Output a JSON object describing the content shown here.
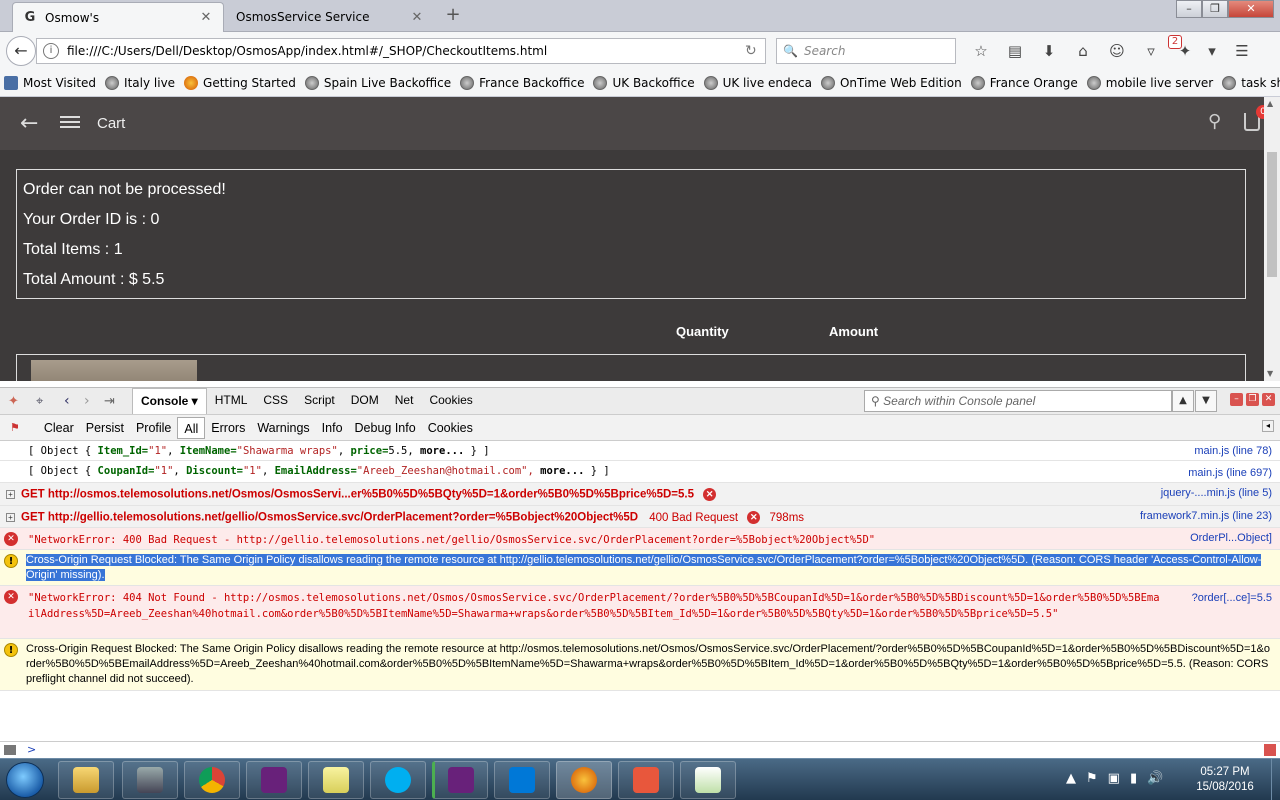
{
  "browser": {
    "tabs": [
      {
        "label": "Osmow's",
        "favicon": "G"
      },
      {
        "label": "OsmosService Service"
      }
    ],
    "new_tab_label": "+",
    "url": "file:///C:/Users/Dell/Desktop/OsmosApp/index.html#/_SHOP/CheckoutItems.html",
    "search_placeholder": "Search",
    "notification_count": "2",
    "bookmarks": [
      "Most Visited",
      "Italy live",
      "Getting Started",
      "Spain Live Backoffice",
      "France Backoffice",
      "UK Backoffice",
      "UK live endeca",
      "OnTime Web Edition",
      "France Orange",
      "mobile live server",
      "task sheet"
    ]
  },
  "app": {
    "title": "Cart",
    "cart_count": "0",
    "order": {
      "status": "Order can not be processed!",
      "order_id": "Your Order ID is : 0",
      "total_items": "Total Items : 1",
      "total_amount": "Total Amount : $ 5.5"
    },
    "columns": {
      "quantity": "Quantity",
      "amount": "Amount"
    }
  },
  "firebug": {
    "tabs": [
      "Console",
      "HTML",
      "CSS",
      "Script",
      "DOM",
      "Net",
      "Cookies"
    ],
    "search_placeholder": "Search within Console panel",
    "filters": [
      "Clear",
      "Persist",
      "Profile",
      "All",
      "Errors",
      "Warnings",
      "Info",
      "Debug Info",
      "Cookies"
    ],
    "log": {
      "obj1": {
        "prefix": "[ Object {",
        "k1": "Item_Id=",
        "v1": "\"1\"",
        "k2": "ItemName=",
        "v2": "\"Shawarma wraps\"",
        "k3": "price=",
        "v3": "5.5,",
        "more": "more...",
        "suffix": "} ]",
        "source": "main.js (line 78)"
      },
      "obj2": {
        "prefix": "[ Object {",
        "k1": "CoupanId=",
        "v1": "\"1\"",
        "k2": "Discount=",
        "v2": "\"1\"",
        "k3": "EmailAddress=",
        "v3": "\"Areeb_Zeeshan@hotmail.com\",",
        "more": "more...",
        "suffix": "} ]",
        "source": "main.js (line 697)"
      },
      "get1": {
        "text": "GET http://osmos.telemosolutions.net/Osmos/OsmosServi...er%5B0%5D%5BQty%5D=1&order%5B0%5D%5Bprice%5D=5.5",
        "source": "jquery-....min.js (line 5)"
      },
      "get2": {
        "text": "GET http://gellio.telemosolutions.net/gellio/OsmosService.svc/OrderPlacement?order=%5Bobject%20Object%5D",
        "status": "400 Bad Request",
        "duration": "798ms",
        "source": "framework7.min.js (line 23)"
      },
      "err1": {
        "text": "\"NetworkError: 400 Bad Request - http://gellio.telemosolutions.net/gellio/OsmosService.svc/OrderPlacement?order=%5Bobject%20Object%5D\"",
        "source": "OrderPl...Object]"
      },
      "warn1": {
        "text": "Cross-Origin Request Blocked: The Same Origin Policy disallows reading the remote resource at http://gellio.telemosolutions.net/gellio/OsmosService.svc/OrderPlacement?order=%5Bobject%20Object%5D. (Reason: CORS header 'Access-Control-Allow-Origin' missing)."
      },
      "err2": {
        "text": "\"NetworkError: 404 Not Found - http://osmos.telemosolutions.net/Osmos/OsmosService.svc/OrderPlacement/?order%5B0%5D%5BCoupanId%5D=1&order%5B0%5D%5BDiscount%5D=1&order%5B0%5D%5BEmailAddress%5D=Areeb_Zeeshan%40hotmail.com&order%5B0%5D%5BItemName%5D=Shawarma+wraps&order%5B0%5D%5BItem_Id%5D=1&order%5B0%5D%5BQty%5D=1&order%5B0%5D%5Bprice%5D=5.5\"",
        "source": "?order[...ce]=5.5"
      },
      "warn2": {
        "text": "Cross-Origin Request Blocked: The Same Origin Policy disallows reading the remote resource at http://osmos.telemosolutions.net/Osmos/OsmosService.svc/OrderPlacement/?order%5B0%5D%5BCoupanId%5D=1&order%5B0%5D%5BDiscount%5D=1&order%5B0%5D%5BEmailAddress%5D=Areeb_Zeeshan%40hotmail.com&order%5B0%5D%5BItemName%5D=Shawarma+wraps&order%5B0%5D%5BItem_Id%5D=1&order%5B0%5D%5BQty%5D=1&order%5B0%5D%5Bprice%5D=5.5. (Reason: CORS preflight channel did not succeed)."
      }
    },
    "prompt": ">"
  },
  "taskbar": {
    "time": "05:27 PM",
    "date": "15/08/2016"
  },
  "colors": {
    "app_bg": "#3d3a3a",
    "app_header": "#4b4747",
    "error": "#cc0000",
    "warning_bg": "#fffde0",
    "error_bg": "#fdebeb",
    "selection": "#3875d7"
  }
}
